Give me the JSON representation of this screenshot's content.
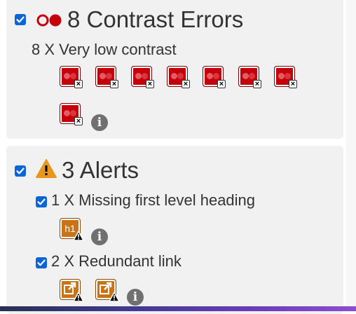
{
  "contrast": {
    "title": "8 Contrast Errors",
    "checked": true,
    "item": {
      "label": "8 X Very low contrast",
      "count": 8,
      "icon": "contrast-error-icon"
    },
    "info": "i"
  },
  "alerts": {
    "title": "3 Alerts",
    "checked": true,
    "items": [
      {
        "label": "1 X Missing first level heading",
        "checked": true,
        "icon_text": "h1",
        "count": 1,
        "icon": "missing-h1-alert-icon"
      },
      {
        "label": "2 X Redundant link",
        "checked": true,
        "count": 2,
        "icon": "redundant-link-alert-icon"
      }
    ],
    "info": "i"
  },
  "colors": {
    "checkbox": "#0b65d8",
    "contrast_error": "#c5000a",
    "alert": "#c97316",
    "warning_triangle": "#e8961c"
  }
}
